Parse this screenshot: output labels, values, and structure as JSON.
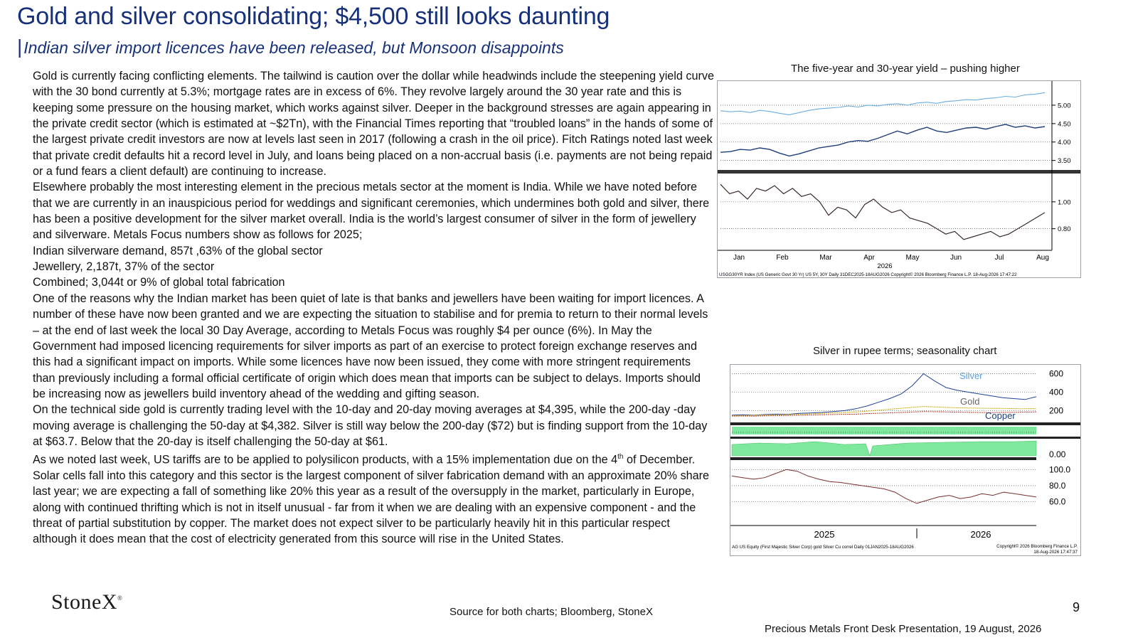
{
  "title": "Gold and silver consolidating; $4,500 still looks daunting",
  "subtitle": "Indian silver import licences have been released, but Monsoon disappoints",
  "paragraphs": [
    "Gold is currently facing conflicting elements.  The tailwind is caution over the dollar while headwinds include the steepening yield curve with the 30 bond currently at 5.3%; mortgage rates are in excess of 6%. They revolve largely around the 30 year rate and this is keeping some pressure on the housing market, which works against silver.  Deeper in the background stresses are again appearing in the private credit sector (which is estimated at ~$2Tn), with the Financial Times reporting that “troubled loans” in the hands of some of the largest private credit investors are now at levels last seen in 2017 (following a crash in the oil price).  Fitch Ratings noted last week that private credit defaults hit a record level in July, and loans being placed on a non-accrual basis (i.e. payments are not being repaid or a fund fears a client default) are continuing to increase.",
    "Elsewhere probably the most interesting element in the precious metals sector at the moment is India. While we have noted before that we are currently in an inauspicious period for weddings and significant ceremonies, which undermines both gold and silver, there has been a positive development for the silver market overall.  India is the world’s largest consumer of silver in the form of jewellery and silverware.  Metals Focus numbers show as follows for 2025;",
    "Indian silverware demand, 857t ,63% of the global sector",
    "Jewellery, 2,187t, 37% of the sector",
    "Combined; 3,044t or 9% of global total fabrication",
    "One of the reasons why the Indian market has been quiet of late is that banks and jewellers have been waiting for import licences.  A number of these have now been granted and we are expecting the situation to stabilise and for premia to return to their normal levels – at the end of last week the local 30 Day Average, according to Metals Focus was roughly $4 per ounce (6%).  In May the Government had imposed licencing requirements for silver imports as part of an exercise to protect foreign exchange reserves and this had a significant impact on imports.  While some licences have now been issued, they come with more stringent requirements than previously including a formal official certificate of origin which does mean that imports can be subject to delays.  Imports should be increasing now as jewellers build inventory ahead of the wedding and gifting season.",
    "On the technical side gold is currently trading level with the 10-day and 20-day moving averages at $4,395, while the 200-day -day moving average is challenging the 50-day at $4,382.  Silver is still way below the 200-day ($72) but is finding support from the 10-day at $63.7.  Below that the 20-day is itself challenging the 50-day at $61."
  ],
  "last_paragraph": {
    "before": "As we noted last week, US tariffs are to be applied to polysilicon products, with a 15% implementation due on the 4",
    "sup": "th",
    "after": " of December.  Solar cells fall into this category and this sector is the largest component of silver fabrication demand with an approximate 20% share last year; we are expecting a fall of something like 20% this year as a result of the oversupply in the market, particularly in Europe, along with continued thrifting which is not in itself unusual - far from it when we are dealing with an expensive component - and the threat of partial substitution by copper.  The market does not expect silver to be particularly heavily hit in this particular respect although it does mean that the cost of electricity generated from this source will rise in the United States."
  },
  "logo": {
    "text": "StoneX",
    "mark": "®"
  },
  "source": "Source for both charts; Bloomberg, StoneX",
  "page_number": "9",
  "footer": "Precious Metals Front Desk Presentation, 19 August, 2026",
  "colors": {
    "title": "#17307a",
    "light_series": "#6aaee0",
    "dark_series": "#1f3f7a",
    "silver": "#1f3f9a",
    "gold": "#c8a800",
    "copper": "#c0392b",
    "green_fill": "#7ee89c",
    "corr_line": "#7b2d2d"
  },
  "chart_data": [
    {
      "type": "line",
      "title": "The five-year and 30-year yield – pushing higher",
      "x_ticks": [
        "Jan",
        "Feb",
        "Mar",
        "Apr",
        "May",
        "Jun",
        "Jul",
        "Aug"
      ],
      "x_year": "2026",
      "upper_y_ticks": [
        "5.00",
        "4.50",
        "4.00",
        "3.50"
      ],
      "upper_ylim": [
        3.3,
        5.5
      ],
      "lower_y_ticks": [
        "1.00",
        "0.80"
      ],
      "lower_ylim": [
        0.65,
        1.2
      ],
      "series": [
        {
          "panel": "upper",
          "values": [
            4.85,
            4.82,
            4.84,
            4.8,
            4.86,
            4.83,
            4.78,
            4.74,
            4.8,
            4.86,
            4.9,
            4.92,
            4.94,
            4.98,
            4.95,
            5.0,
            4.98,
            5.02,
            5.04,
            5.0,
            5.06,
            5.08,
            5.05,
            5.1,
            5.12,
            5.15,
            5.14,
            5.18,
            5.2,
            5.24,
            5.22,
            5.28,
            5.3,
            5.34
          ]
        },
        {
          "panel": "upper",
          "values": [
            3.72,
            3.74,
            3.8,
            3.78,
            3.84,
            3.8,
            3.7,
            3.62,
            3.68,
            3.76,
            3.84,
            3.88,
            3.92,
            4.0,
            4.04,
            4.02,
            4.1,
            4.2,
            4.3,
            4.22,
            4.32,
            4.4,
            4.3,
            4.26,
            4.32,
            4.38,
            4.4,
            4.35,
            4.42,
            4.48,
            4.4,
            4.44,
            4.38,
            4.42
          ]
        },
        {
          "panel": "lower",
          "values": [
            1.13,
            1.06,
            1.08,
            1.02,
            1.1,
            1.08,
            1.12,
            1.06,
            1.1,
            1.04,
            1.06,
            1.0,
            0.9,
            0.96,
            0.94,
            0.88,
            0.98,
            1.02,
            0.96,
            0.92,
            0.94,
            0.88,
            0.86,
            0.84,
            0.8,
            0.76,
            0.78,
            0.72,
            0.74,
            0.76,
            0.78,
            0.74,
            0.76,
            0.8,
            0.84,
            0.88,
            0.92
          ]
        }
      ],
      "footnote": "USGG30YR Index (US Generic Govt 30 Yr) US 5Y, 30Y Daily 31DEC2025-18AUG2026   Copyright© 2026 Bloomberg Finance L.P.   18-Aug-2026 17:47:22"
    },
    {
      "type": "line",
      "title": "Silver in rupee terms; seasonality chart",
      "x_ticks": [
        "2025",
        "2026"
      ],
      "upper_y_ticks": [
        "600",
        "400",
        "200"
      ],
      "upper_ylim": [
        80,
        650
      ],
      "middle_y_ticks": [
        "0.00"
      ],
      "lower_y_ticks": [
        "100.0",
        "80.0",
        "60.0"
      ],
      "lower_ylim": [
        50,
        110
      ],
      "series": [
        {
          "name": "Silver",
          "panel": "upper",
          "values": [
            150,
            155,
            150,
            158,
            162,
            160,
            170,
            175,
            180,
            190,
            200,
            220,
            250,
            290,
            330,
            380,
            470,
            600,
            520,
            450,
            420,
            400,
            380,
            360,
            340,
            330,
            320,
            350
          ]
        },
        {
          "name": "Gold",
          "panel": "upper",
          "values": [
            145,
            148,
            150,
            152,
            155,
            158,
            160,
            165,
            170,
            175,
            180,
            185,
            195,
            205,
            215,
            225,
            235,
            245,
            240,
            235,
            230,
            228,
            226,
            225,
            224,
            222,
            220,
            222
          ]
        },
        {
          "name": "Copper",
          "panel": "upper",
          "values": [
            140,
            142,
            140,
            144,
            146,
            148,
            150,
            152,
            155,
            158,
            160,
            162,
            168,
            172,
            176,
            180,
            185,
            190,
            188,
            186,
            184,
            182,
            180,
            178,
            180,
            182,
            184,
            186
          ]
        },
        {
          "panel": "lower",
          "values": [
            92,
            90,
            88,
            90,
            95,
            100,
            98,
            92,
            88,
            85,
            84,
            82,
            80,
            78,
            76,
            72,
            64,
            58,
            62,
            66,
            68,
            64,
            66,
            70,
            68,
            72,
            70,
            68,
            66
          ]
        }
      ],
      "footnote_left": "AG US Equity (First Majestic Silver Corp) gold Silver Cu correl Daily 01JAN2025-18AUG2026",
      "footnote_right_1": "Copyright© 2026 Bloomberg Finance L.P.",
      "footnote_right_2": "18-Aug-2026 17:47:37"
    }
  ]
}
